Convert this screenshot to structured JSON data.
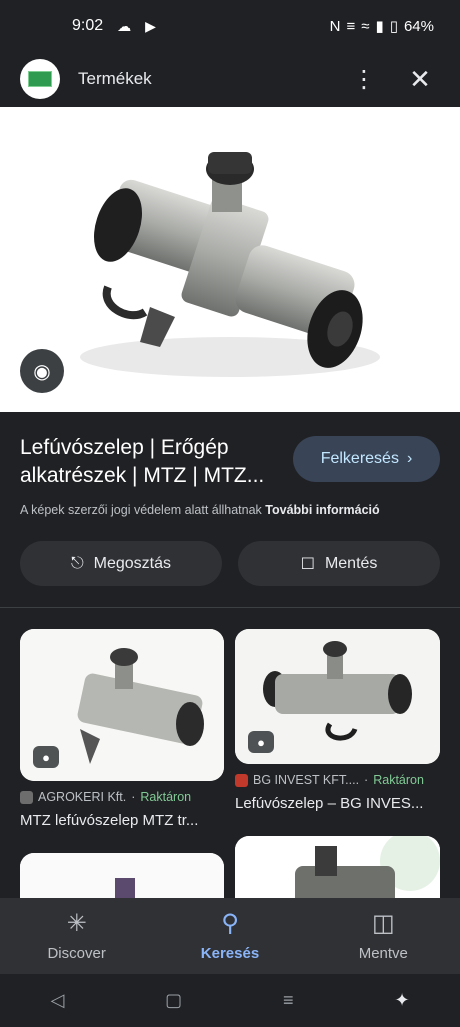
{
  "status": {
    "time": "9:02",
    "battery": "64%"
  },
  "topbar": {
    "title": "Termékek"
  },
  "result": {
    "title": "Lefúvószelep | Erőgép alkatrészek | MTZ | MTZ...",
    "visit_label": "Felkeresés",
    "copyright_text": "A képek szerzői jogi védelem alatt állhatnak",
    "copyright_link": "További információ",
    "share_label": "Megosztás",
    "save_label": "Mentés"
  },
  "cards": [
    {
      "source": "AGROKERI Kft.",
      "stock": "Raktáron",
      "title": "MTZ lefúvószelep MTZ tr..."
    },
    {
      "source": "BG INVEST KFT....",
      "stock": "Raktáron",
      "title": "Lefúvószelep – BG INVES..."
    }
  ],
  "nav": {
    "discover": "Discover",
    "search": "Keresés",
    "saved": "Mentve"
  },
  "colors": {
    "accent": "#8ab4f8",
    "stock": "#81c995",
    "visit_bg": "#394457"
  }
}
